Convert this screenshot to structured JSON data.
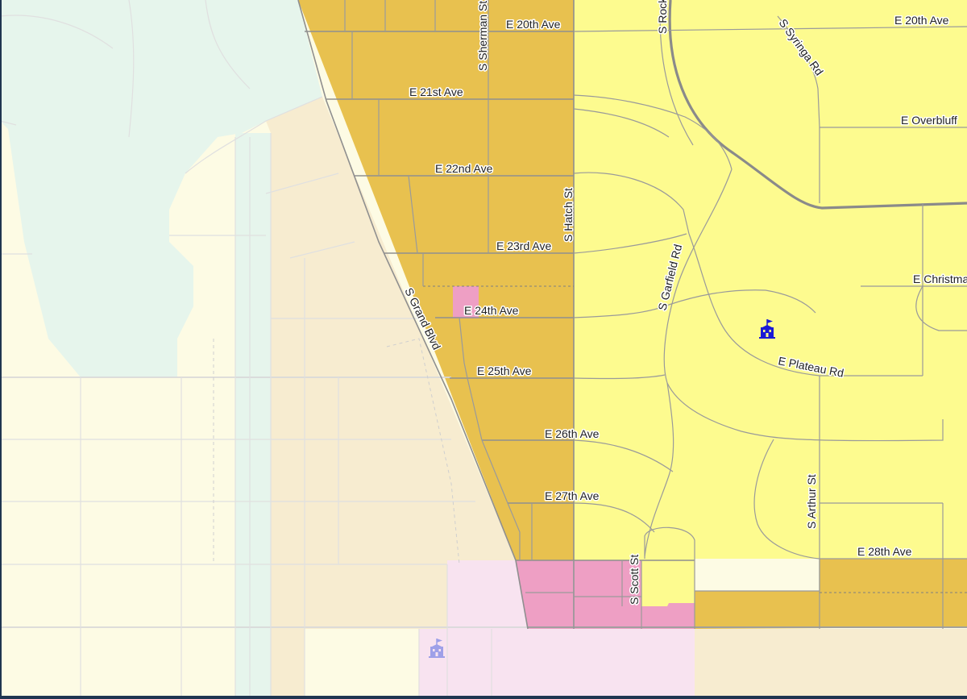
{
  "colors": {
    "zone_dark_yellow": "#e8c14f",
    "zone_light_yellow": "#fdfb8f",
    "zone_pink": "#ee9fc4",
    "zone_faded_pink": "#f8e3f0",
    "zone_faded_tan": "#f7ecd0",
    "zone_faded_cream": "#fdfbe4",
    "zone_faded_green": "#e6f5ec",
    "school_icon_active": "#1a1ad6",
    "school_icon_faded": "#9ea0e8",
    "frame_border": "#1f3550"
  },
  "streets": {
    "e_20th_ave_west": "E 20th Ave",
    "e_20th_ave_east": "E 20th Ave",
    "s_sherman_st": "S Sherman St",
    "s_rockwood": "S Rock",
    "s_syringa_rd": "S Syringa Rd",
    "e_21st_ave": "E 21st Ave",
    "e_overbluff": "E Overbluff",
    "e_22nd_ave": "E 22nd Ave",
    "s_hatch_st": "S Hatch St",
    "e_23rd_ave": "E 23rd Ave",
    "s_garfield_rd": "S Garfield Rd",
    "s_grand_blvd": "S Grand Blvd",
    "e_24th_ave": "E 24th Ave",
    "e_christmas": "E Christma",
    "e_25th_ave": "E 25th Ave",
    "e_plateau_rd": "E Plateau Rd",
    "e_26th_ave": "E 26th Ave",
    "e_27th_ave": "E 27th Ave",
    "s_arthur_st": "S Arthur St",
    "e_28th_ave": "E 28th Ave",
    "s_scott_st": "S Scott St"
  },
  "icons": {
    "school_active": "school-icon",
    "school_faded": "school-icon"
  }
}
